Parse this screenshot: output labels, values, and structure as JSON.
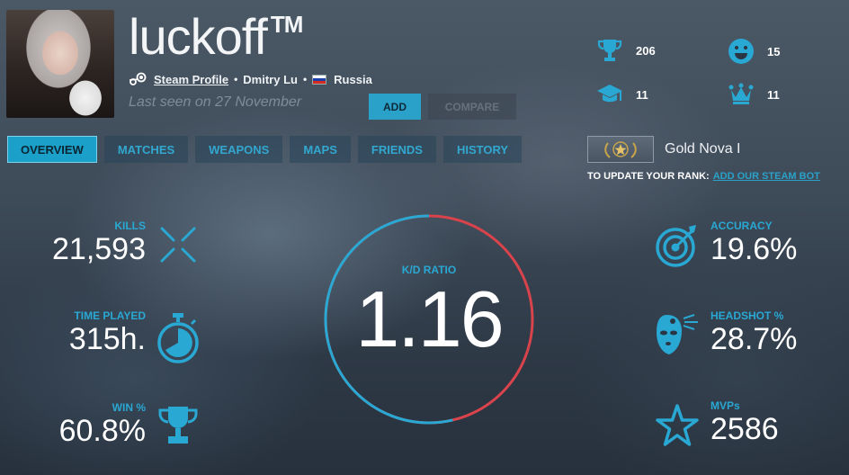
{
  "profile": {
    "username": "luckoff",
    "trademark": "TM",
    "steam_profile_label": "Steam Profile",
    "real_name": "Dmitry Lu",
    "country": "Russia",
    "last_seen": "Last seen on 27 November",
    "add_label": "ADD",
    "compare_label": "COMPARE"
  },
  "tabs": [
    "OVERVIEW",
    "MATCHES",
    "WEAPONS",
    "MAPS",
    "FRIENDS",
    "HISTORY"
  ],
  "profile_stats": {
    "trophies": "206",
    "smiley": "15",
    "graduation": "11",
    "crown": "11"
  },
  "rank": {
    "name": "Gold Nova I",
    "update_text": "TO UPDATE YOUR RANK:",
    "bot_link": "ADD OUR STEAM BOT"
  },
  "stats": {
    "kills": {
      "label": "KILLS",
      "value": "21,593"
    },
    "time_played": {
      "label": "TIME PLAYED",
      "value": "315h."
    },
    "win": {
      "label": "WIN %",
      "value": "60.8%"
    },
    "accuracy": {
      "label": "ACCURACY",
      "value": "19.6%"
    },
    "headshot": {
      "label": "HEADSHOT %",
      "value": "28.7%"
    },
    "mvps": {
      "label": "MVPs",
      "value": "2586"
    }
  },
  "kd": {
    "label": "K/D RATIO",
    "value": "1.16",
    "ratio": 1.16
  },
  "colors": {
    "accent": "#29a8d3",
    "kd_death": "#d9434c"
  }
}
